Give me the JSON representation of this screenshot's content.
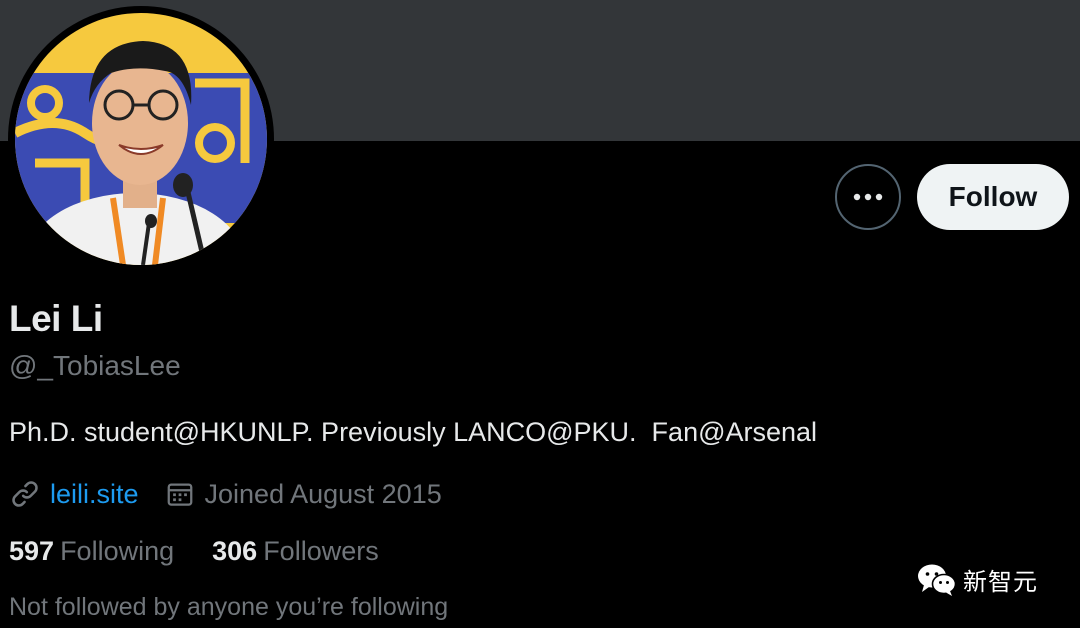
{
  "profile": {
    "name": "Lei Li",
    "handle": "@_TobiasLee",
    "bio": "Ph.D. student@HKUNLP. Previously LANCO@PKU.  Fan@Arsenal",
    "website": "leili.site",
    "joined": "Joined August 2015",
    "following_count": "597",
    "following_label": "Following",
    "followers_count": "306",
    "followers_label": "Followers",
    "followed_by_note": "Not followed by anyone you’re following"
  },
  "actions": {
    "more_icon": "more-horizontal-icon",
    "follow_label": "Follow"
  },
  "icons": {
    "website": "link-icon",
    "joined": "calendar-icon",
    "watermark": "wechat-icon"
  },
  "watermark": {
    "text": "新智元"
  },
  "colors": {
    "background": "#000000",
    "banner": "#333639",
    "primary_text": "#e7e9ea",
    "secondary_text": "#71767b",
    "link": "#1d9bf0",
    "follow_button_bg": "#eff3f4",
    "follow_button_text": "#0f1419",
    "border": "#536471"
  }
}
